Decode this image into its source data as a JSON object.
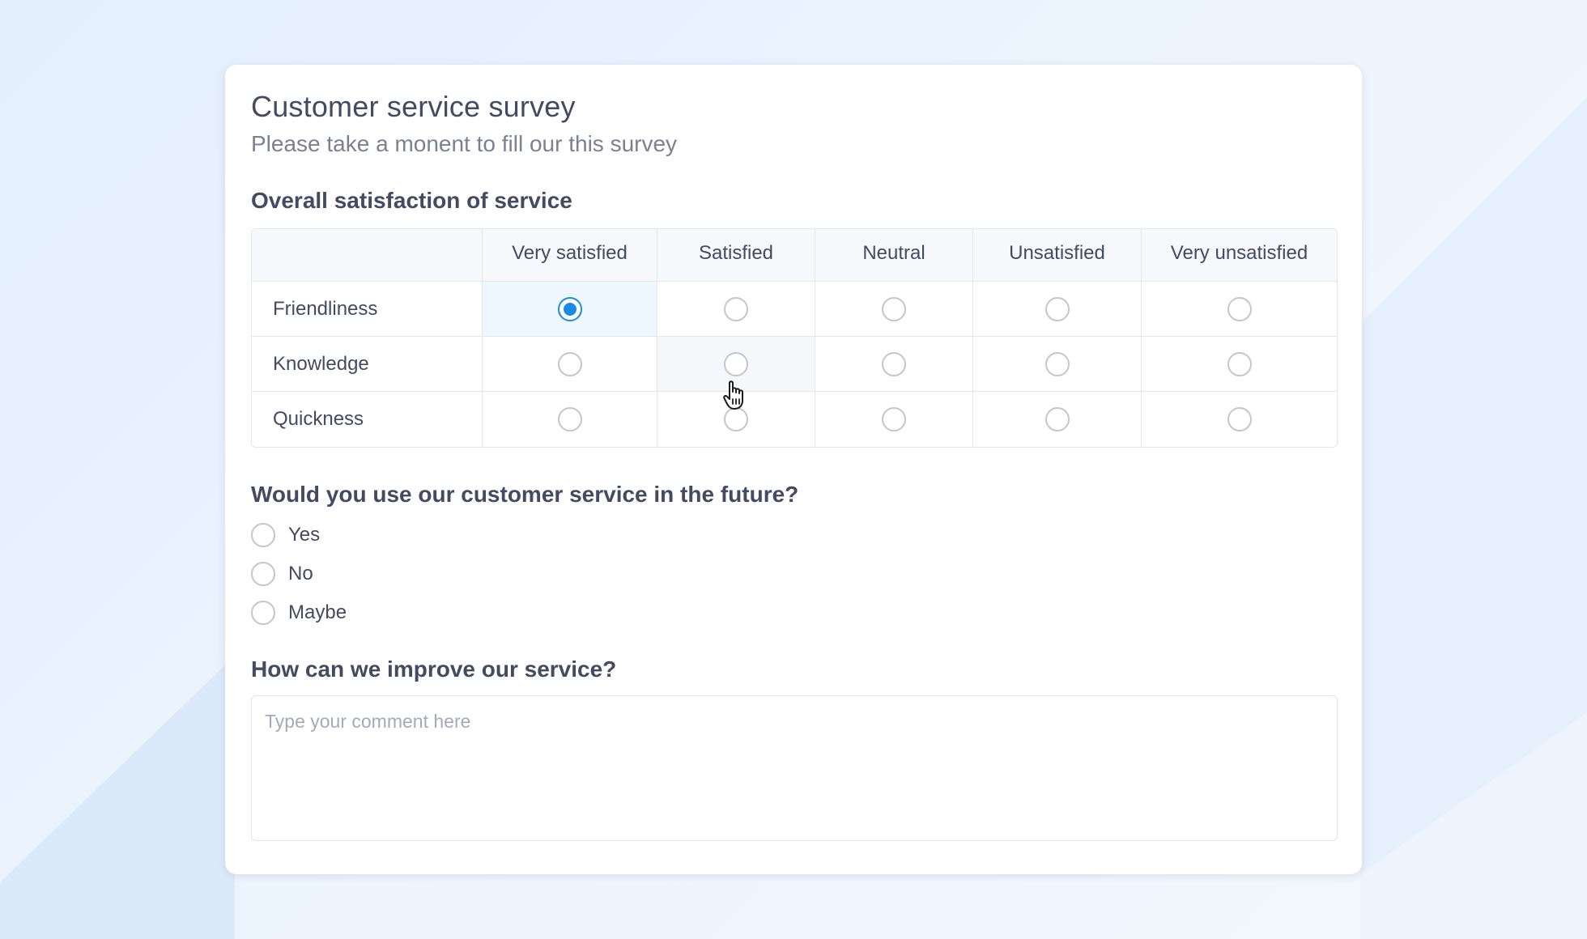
{
  "survey": {
    "title": "Customer service survey",
    "subtitle": "Please take a monent to fill our this survey"
  },
  "matrix_question": {
    "title": "Overall satisfaction of service",
    "columns": [
      "Very satisfied",
      "Satisfied",
      "Neutral",
      "Unsatisfied",
      "Very unsatisfied"
    ],
    "rows": [
      {
        "label": "Friendliness",
        "selected": "Very satisfied"
      },
      {
        "label": "Knowledge",
        "selected": null
      },
      {
        "label": "Quickness",
        "selected": null
      }
    ]
  },
  "future_question": {
    "title": "Would you use our customer service in the future?",
    "options": [
      "Yes",
      "No",
      "Maybe"
    ],
    "selected": null
  },
  "improve_question": {
    "title": "How can we improve our service?",
    "placeholder": "Type your comment here",
    "value": ""
  },
  "colors": {
    "accent": "#1b8be6",
    "text": "#454a63",
    "muted": "#7c8095"
  },
  "icons": {
    "cursor": "hand-pointer-icon"
  }
}
